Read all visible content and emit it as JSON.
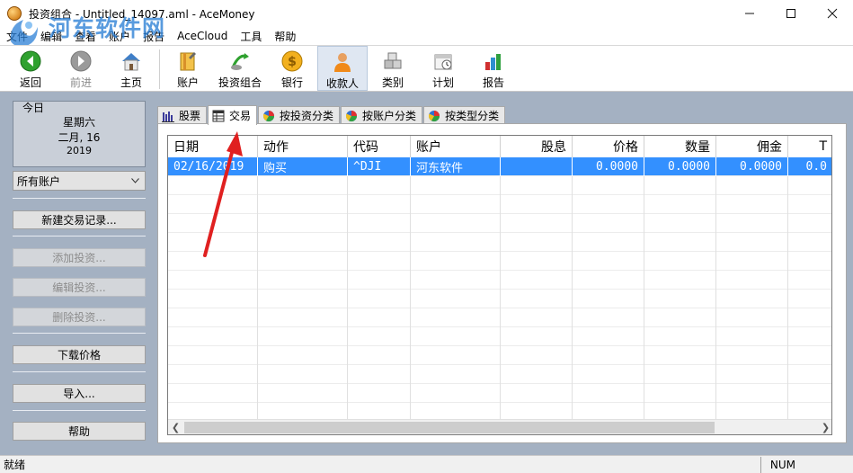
{
  "window": {
    "title": "投资组合 - Untitled_14097.aml - AceMoney",
    "min_icon": "minimize-icon",
    "max_icon": "maximize-icon",
    "close_icon": "close-icon"
  },
  "watermark": {
    "text": "河东软件网",
    "url": "www.pc0359.cn"
  },
  "menu": [
    "文件",
    "编辑",
    "查看",
    "账户",
    "报告",
    "AceCloud",
    "工具",
    "帮助"
  ],
  "toolbar": {
    "back": "返回",
    "forward": "前进",
    "home": "主页",
    "accounts": "账户",
    "portfolio": "投资组合",
    "banks": "银行",
    "payees": "收款人",
    "categories": "类别",
    "schedule": "计划",
    "reports": "报告"
  },
  "left": {
    "today_label": "今日",
    "weekday": "星期六",
    "month_day": "二月, 16",
    "year": "2019",
    "account_select": "所有账户",
    "new_transaction": "新建交易记录...",
    "add_investment": "添加投资...",
    "edit_investment": "编辑投资...",
    "delete_investment": "删除投资...",
    "download_prices": "下载价格",
    "import": "导入...",
    "help": "帮助"
  },
  "tabs": [
    {
      "label": "股票",
      "icon": "bar-chart-icon"
    },
    {
      "label": "交易",
      "icon": "ledger-icon"
    },
    {
      "label": "按投资分类",
      "icon": "pie-chart-icon"
    },
    {
      "label": "按账户分类",
      "icon": "pie-chart-icon"
    },
    {
      "label": "按类型分类",
      "icon": "pie-chart-icon"
    }
  ],
  "grid": {
    "columns": [
      "日期",
      "动作",
      "代码",
      "账户",
      "股息",
      "价格",
      "数量",
      "佣金",
      "T"
    ],
    "rows": [
      [
        "02/16/2019",
        "购买",
        "^DJI",
        "河东软件",
        "",
        "0.0000",
        "0.0000",
        "0.0000",
        "0.0"
      ]
    ]
  },
  "status": {
    "text": "就绪",
    "num": "NUM"
  },
  "colors": {
    "selection": "#3390ff",
    "background": "#a4b1c2",
    "annotation_arrow": "#e02020"
  }
}
